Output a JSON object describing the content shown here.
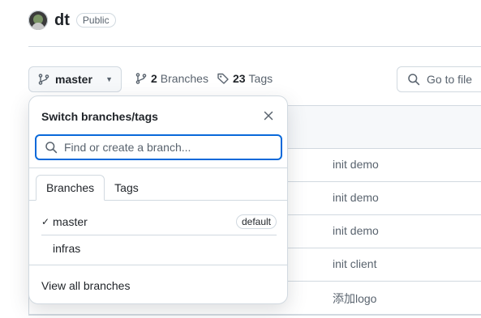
{
  "repo": {
    "name": "dt",
    "visibility": "Public"
  },
  "branch_selector": {
    "current": "master",
    "branches_count": "2",
    "branches_label": "Branches",
    "tags_count": "23",
    "tags_label": "Tags"
  },
  "goto_file": {
    "placeholder": "Go to file"
  },
  "popover": {
    "title": "Switch branches/tags",
    "search_placeholder": "Find or create a branch...",
    "tabs": [
      "Branches",
      "Tags"
    ],
    "branches": [
      {
        "name": "master",
        "selected": true,
        "badge": "default"
      },
      {
        "name": "infras",
        "selected": false,
        "badge": ""
      }
    ],
    "check_glyph": "✓",
    "view_all": "View all branches"
  },
  "files": [
    {
      "message": "init demo"
    },
    {
      "message": "init demo"
    },
    {
      "message": "init demo"
    },
    {
      "message": "init client"
    },
    {
      "message": "添加logo"
    }
  ],
  "icons": {
    "branch": "git-branch-icon",
    "tag": "tag-icon",
    "search": "search-icon",
    "close": "close-icon",
    "caret": "caret-down-icon"
  }
}
